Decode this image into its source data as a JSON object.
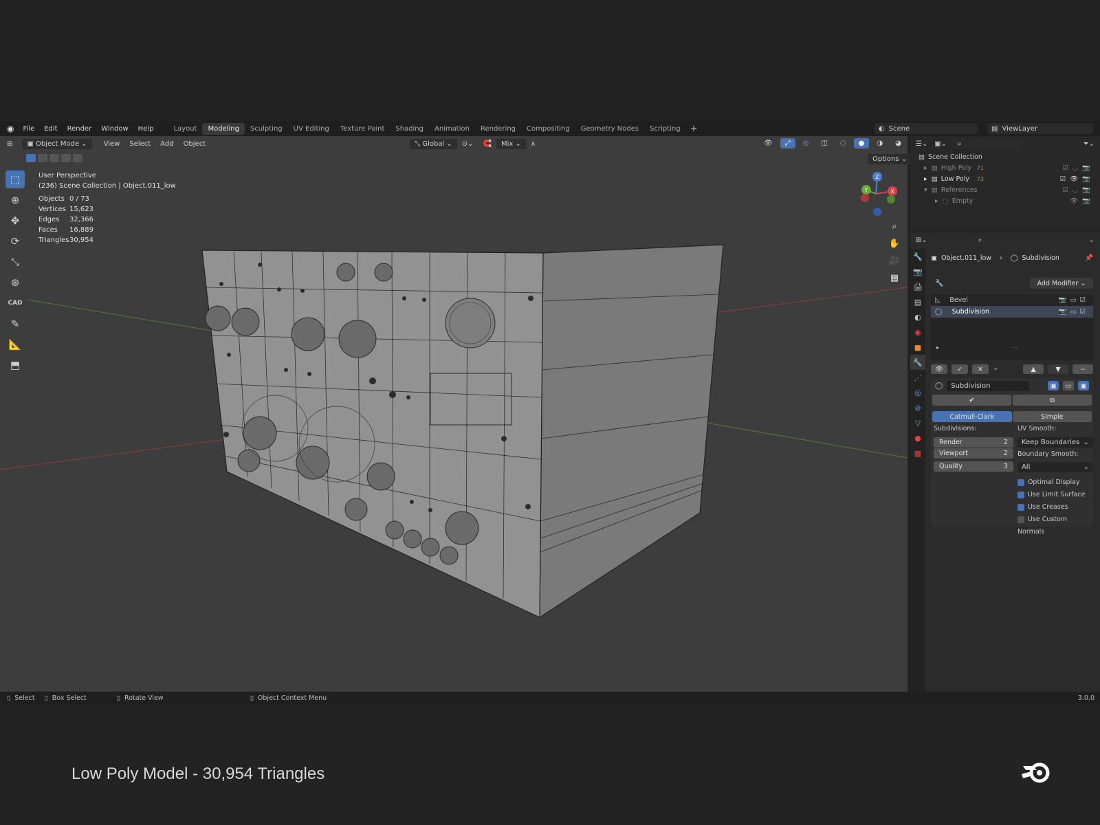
{
  "topbar": {
    "menus": [
      "File",
      "Edit",
      "Render",
      "Window",
      "Help"
    ],
    "workspaces": [
      "Layout",
      "Modeling",
      "Sculpting",
      "UV Editing",
      "Texture Paint",
      "Shading",
      "Animation",
      "Rendering",
      "Compositing",
      "Geometry Nodes",
      "Scripting"
    ],
    "active_workspace": "Modeling",
    "scene": "Scene",
    "view_layer": "ViewLayer"
  },
  "viewport_header": {
    "mode": "Object Mode",
    "menus": [
      "View",
      "Select",
      "Add",
      "Object"
    ],
    "orientation": "Global",
    "snap": "Mix",
    "options": "Options"
  },
  "viewport": {
    "perspective": "User Perspective",
    "context": "(236) Scene Collection | Object.011_low",
    "stats": [
      {
        "label": "Objects",
        "value": "0 / 73"
      },
      {
        "label": "Vertices",
        "value": "15,623"
      },
      {
        "label": "Edges",
        "value": "32,366"
      },
      {
        "label": "Faces",
        "value": "16,889"
      },
      {
        "label": "Triangles",
        "value": "30,954"
      }
    ],
    "gizmo": {
      "z": "Z",
      "y": "Y",
      "x": "X"
    },
    "cad_label": "CAD"
  },
  "outliner": {
    "root": "Scene Collection",
    "items": [
      {
        "name": "High Poly",
        "badge": "71"
      },
      {
        "name": "Low Poly",
        "badge": "73"
      },
      {
        "name": "References",
        "badge": ""
      },
      {
        "name": "Empty",
        "badge": ""
      }
    ]
  },
  "properties": {
    "breadcrumb_object": "Object.011_low",
    "breadcrumb_modifier": "Subdivision",
    "add_modifier": "Add Modifier",
    "modifiers": [
      "Bevel",
      "Subdivision"
    ],
    "active_name": "Subdivision",
    "mode_catmull": "Catmull-Clark",
    "mode_simple": "Simple",
    "subdivisions_label": "Subdivisions:",
    "render_label": "Render",
    "render_value": "2",
    "viewport_label": "Viewport",
    "viewport_value": "2",
    "quality_label": "Quality",
    "quality_value": "3",
    "uv_smooth_label": "UV Smooth:",
    "uv_smooth_value": "Keep Boundaries",
    "boundary_smooth_label": "Boundary Smooth:",
    "boundary_smooth_value": "All",
    "checkboxes": [
      {
        "label": "Optimal Display",
        "checked": true
      },
      {
        "label": "Use Limit Surface",
        "checked": true
      },
      {
        "label": "Use Creases",
        "checked": true
      },
      {
        "label": "Use Custom Normals",
        "checked": false
      }
    ]
  },
  "statusbar": {
    "select": "Select",
    "box_select": "Box Select",
    "rotate_view": "Rotate View",
    "context_menu": "Object Context Menu",
    "version": "3.0.0"
  },
  "caption": "Low Poly Model - 30,954 Triangles"
}
